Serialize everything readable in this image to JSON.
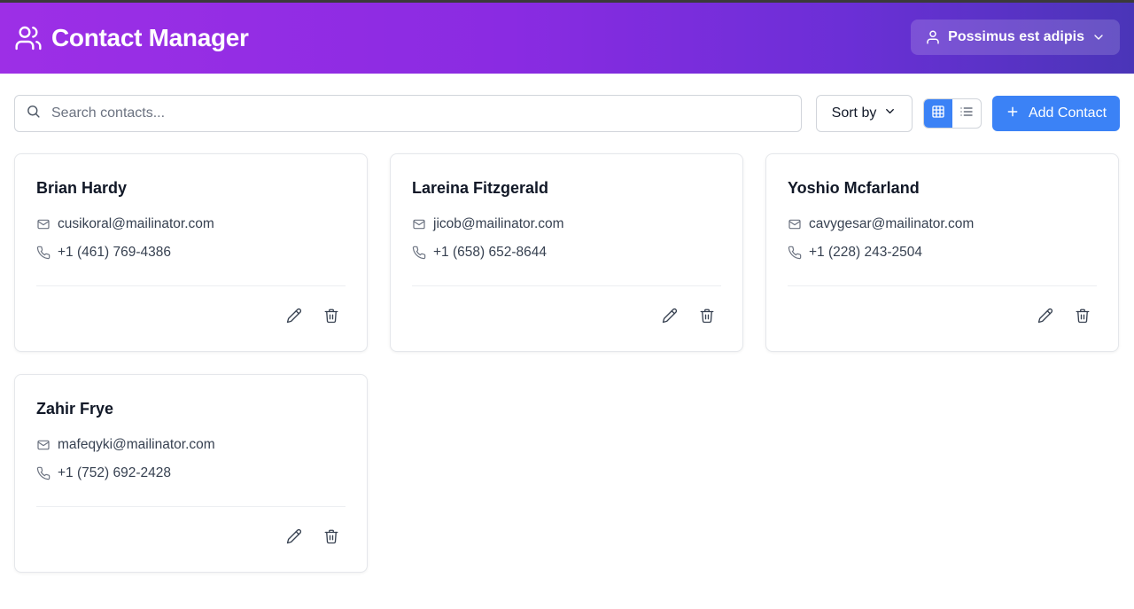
{
  "app": {
    "title": "Contact Manager",
    "user_name": "Possimus est adipis"
  },
  "toolbar": {
    "search_placeholder": "Search contacts...",
    "sort_label": "Sort by",
    "add_label": "Add Contact",
    "view_mode": "grid"
  },
  "contacts": [
    {
      "name": "Brian Hardy",
      "email": "cusikoral@mailinator.com",
      "phone": "+1 (461) 769-4386"
    },
    {
      "name": "Lareina Fitzgerald",
      "email": "jicob@mailinator.com",
      "phone": "+1 (658) 652-8644"
    },
    {
      "name": "Yoshio Mcfarland",
      "email": "cavygesar@mailinator.com",
      "phone": "+1 (228) 243-2504"
    },
    {
      "name": "Zahir Frye",
      "email": "mafeqyki@mailinator.com",
      "phone": "+1 (752) 692-2428"
    }
  ],
  "colors": {
    "accent": "#3b82f6",
    "header_start": "#9d2fe6",
    "header_end": "#4a35b8"
  },
  "icons": {
    "brand": "users-icon",
    "user": "user-icon",
    "search": "search-icon",
    "email": "mail-icon",
    "phone": "phone-icon",
    "edit": "pencil-icon",
    "delete": "trash-icon"
  }
}
